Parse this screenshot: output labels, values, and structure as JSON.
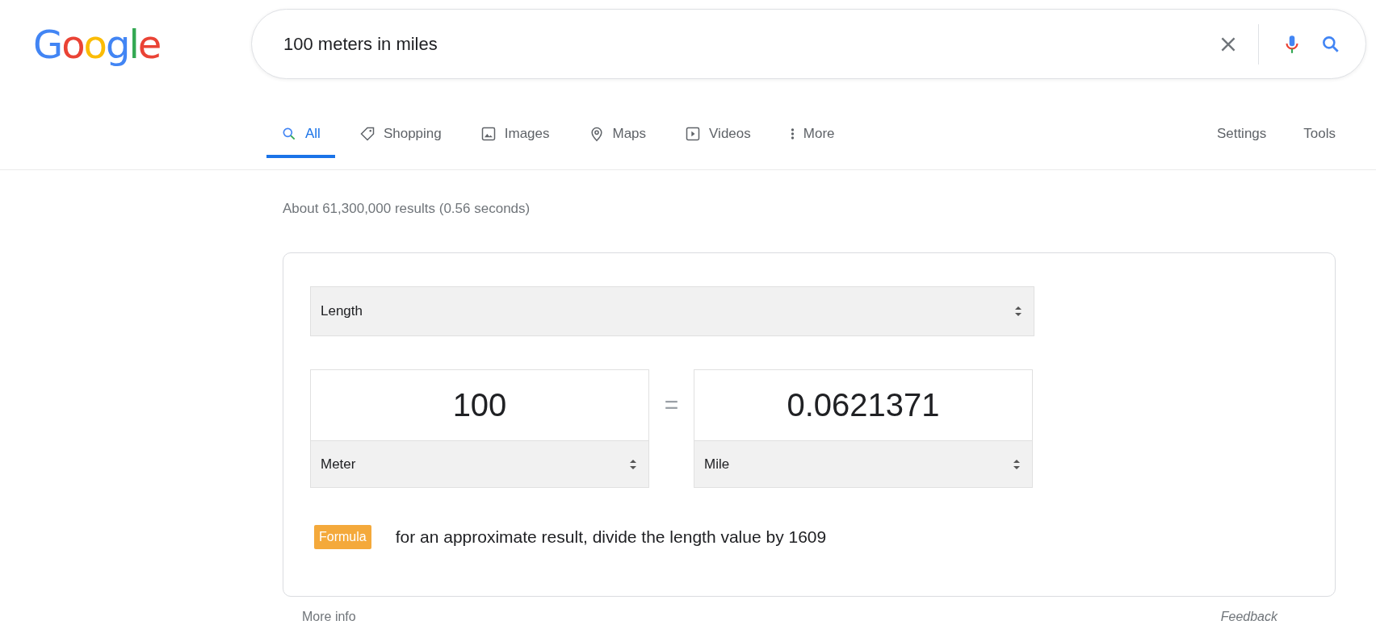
{
  "logo": {
    "letters": [
      {
        "text": "G",
        "color": "#4285f4"
      },
      {
        "text": "o",
        "color": "#ea4335"
      },
      {
        "text": "o",
        "color": "#fbbc05"
      },
      {
        "text": "g",
        "color": "#4285f4"
      },
      {
        "text": "l",
        "color": "#34a853"
      },
      {
        "text": "e",
        "color": "#ea4335"
      }
    ]
  },
  "search": {
    "value": "100 meters in miles"
  },
  "tabs": [
    {
      "label": "All",
      "kind": "search",
      "selected": true
    },
    {
      "label": "Shopping",
      "kind": "tag",
      "selected": false
    },
    {
      "label": "Images",
      "kind": "image",
      "selected": false
    },
    {
      "label": "Maps",
      "kind": "pin",
      "selected": false
    },
    {
      "label": "Videos",
      "kind": "play",
      "selected": false
    },
    {
      "label": "More",
      "kind": "dots",
      "selected": false
    }
  ],
  "tools": [
    "Settings",
    "Tools"
  ],
  "result_stats": "About 61,300,000 results (0.56 seconds)",
  "converter": {
    "category": "Length",
    "from": {
      "value": "100",
      "unit": "Meter"
    },
    "equals": "=",
    "to": {
      "value": "0.0621371",
      "unit": "Mile"
    },
    "formula": {
      "badge": "Formula",
      "text": "for an approximate result, divide the length value by 1609"
    }
  },
  "footer": {
    "more_info": "More info",
    "feedback": "Feedback"
  }
}
